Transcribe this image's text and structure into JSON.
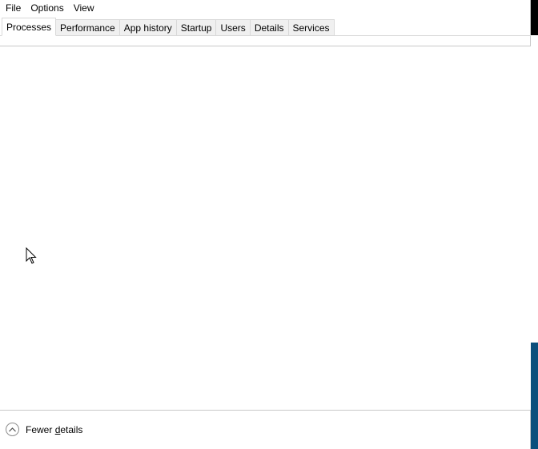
{
  "menu": {
    "items": [
      {
        "label": "File"
      },
      {
        "label": "Options"
      },
      {
        "label": "View"
      }
    ]
  },
  "tabs": [
    {
      "label": "Processes",
      "active": true
    },
    {
      "label": "Performance",
      "active": false
    },
    {
      "label": "App history",
      "active": false
    },
    {
      "label": "Startup",
      "active": false
    },
    {
      "label": "Users",
      "active": false
    },
    {
      "label": "Details",
      "active": false
    },
    {
      "label": "Services",
      "active": false
    }
  ],
  "footer": {
    "toggle_label_pre": "Fewer ",
    "toggle_label_ul": "d",
    "toggle_label_post": "etails",
    "toggle_icon": "chevron-up-icon"
  },
  "colors": {
    "tab_border": "#d9d9d9",
    "tab_inactive_bg": "#f0f0f0",
    "accent_blue": "#0b4f7c"
  }
}
